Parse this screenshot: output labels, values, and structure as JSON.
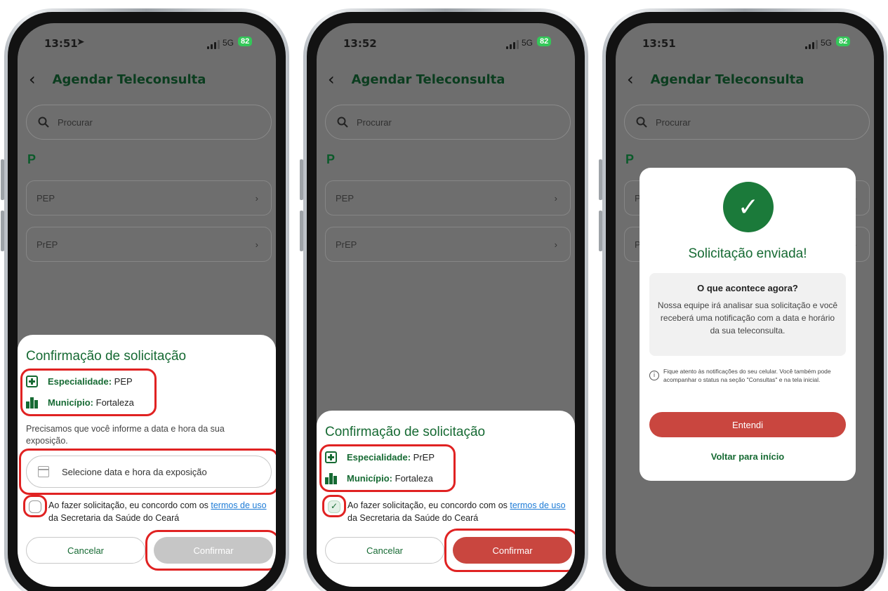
{
  "app": {
    "screen_title": "Agendar Teleconsulta",
    "search_placeholder": "Procurar",
    "section_letter": "P",
    "list_items": [
      {
        "label": "PEP"
      },
      {
        "label": "PrEP"
      }
    ],
    "network": "5G",
    "battery": "82"
  },
  "screens": [
    {
      "time": "13:51",
      "sheet": {
        "title": "Confirmação de solicitação",
        "specialty_label": "Especialidade:",
        "specialty_value": "PEP",
        "municipality_label": "Município:",
        "municipality_value": "Fortaleza",
        "instruction": "Precisamos que você informe a data e hora da sua exposição.",
        "date_placeholder": "Selecione data e hora da exposição",
        "terms_prefix": "Ao fazer solicitação, eu concordo com os ",
        "terms_link": "termos de uso",
        "terms_suffix": " da Secretaria da Saúde do Ceará",
        "checkbox_checked": false,
        "cancel_label": "Cancelar",
        "confirm_label": "Confirmar",
        "confirm_enabled": false
      }
    },
    {
      "time": "13:52",
      "sheet": {
        "title": "Confirmação de solicitação",
        "specialty_label": "Especialidade:",
        "specialty_value": "PrEP",
        "municipality_label": "Município:",
        "municipality_value": "Fortaleza",
        "terms_prefix": "Ao fazer solicitação, eu concordo com os ",
        "terms_link": "termos de uso",
        "terms_suffix": " da Secretaria da Saúde do Ceará",
        "checkbox_checked": true,
        "cancel_label": "Cancelar",
        "confirm_label": "Confirmar",
        "confirm_enabled": true
      }
    },
    {
      "time": "13:51",
      "modal": {
        "title": "Solicitação enviada!",
        "box_heading": "O que acontece agora?",
        "box_text": "Nossa equipe irá analisar sua solicitação e você receberá uma notificação com a data e horário da sua teleconsulta.",
        "note": "Fique atento às notificações do seu celular. Você também pode acompanhar o status na seção \"Consultas\" e na tela inicial.",
        "ok_label": "Entendi",
        "home_label": "Voltar para início"
      }
    }
  ],
  "colors": {
    "brand_green": "#166a33",
    "confirm_red": "#c9463f",
    "disabled_grey": "#c6c6c6",
    "highlight_red": "#e02222",
    "overlay_grey": "#6e6e6e"
  }
}
